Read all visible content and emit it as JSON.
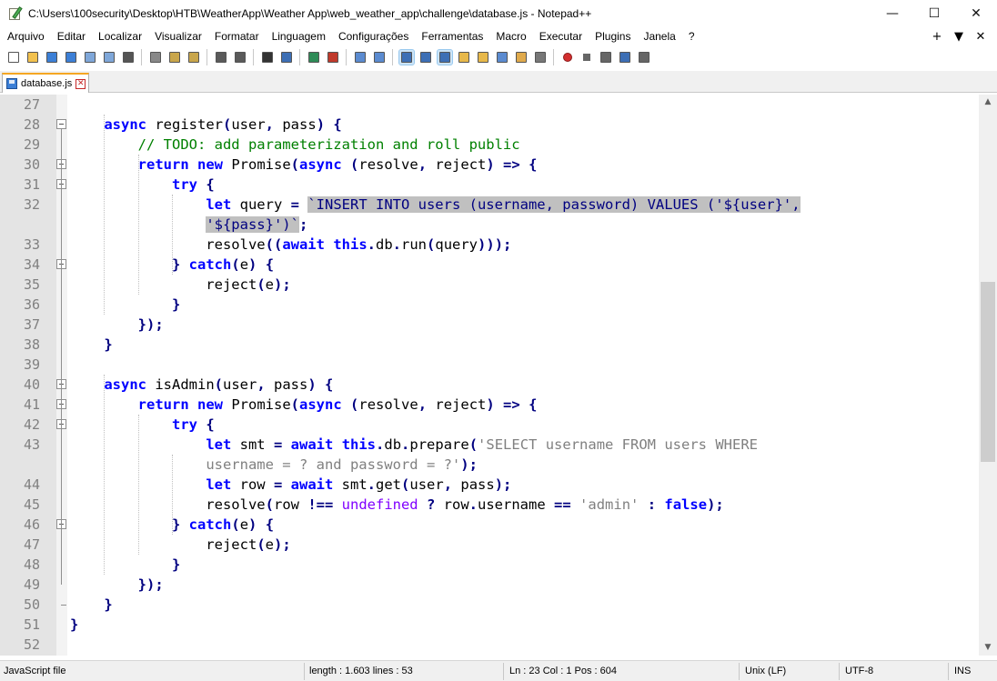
{
  "window": {
    "title": "C:\\Users\\100security\\Desktop\\HTB\\WeatherApp\\Weather App\\web_weather_app\\challenge\\database.js - Notepad++",
    "minimize": "—",
    "maximize": "☐",
    "close": "✕"
  },
  "menu": {
    "items": [
      "Arquivo",
      "Editar",
      "Localizar",
      "Visualizar",
      "Formatar",
      "Linguagem",
      "Configurações",
      "Ferramentas",
      "Macro",
      "Executar",
      "Plugins",
      "Janela",
      "?"
    ],
    "right": [
      "+",
      "▼",
      "✕"
    ]
  },
  "toolbar": {
    "icons": [
      "new-file-icon",
      "open-file-icon",
      "save-icon",
      "save-all-icon",
      "close-icon",
      "close-all-icon",
      "print-icon",
      "cut-icon",
      "copy-icon",
      "paste-icon",
      "undo-icon",
      "redo-icon",
      "find-icon",
      "replace-icon",
      "zoom-in-icon",
      "zoom-out-icon",
      "sync-vertical-icon",
      "sync-horizontal-icon",
      "word-wrap-icon",
      "show-all-chars-icon",
      "indent-guide-icon",
      "udl-icon",
      "doc-map-icon",
      "function-list-icon",
      "folder-workspace-icon",
      "monitoring-icon",
      "record-macro-icon",
      "stop-macro-icon",
      "play-macro-icon",
      "run-macro-multiple-icon",
      "save-macro-icon"
    ]
  },
  "tab": {
    "label": "database.js",
    "close": "✕"
  },
  "editor": {
    "lines": [
      {
        "n": "27",
        "tokens": []
      },
      {
        "n": "28",
        "tokens": [
          [
            "pl",
            "    "
          ],
          [
            "kw",
            "async"
          ],
          [
            "pl",
            " register"
          ],
          [
            "op",
            "("
          ],
          [
            "pl",
            "user"
          ],
          [
            "op",
            ","
          ],
          [
            "pl",
            " pass"
          ],
          [
            "op",
            ")"
          ],
          [
            "pl",
            " "
          ],
          [
            "op",
            "{"
          ]
        ]
      },
      {
        "n": "29",
        "tokens": [
          [
            "pl",
            "        "
          ],
          [
            "cm",
            "// TODO: add parameterization and roll public"
          ]
        ]
      },
      {
        "n": "30",
        "tokens": [
          [
            "pl",
            "        "
          ],
          [
            "kw",
            "return"
          ],
          [
            "pl",
            " "
          ],
          [
            "kw",
            "new"
          ],
          [
            "pl",
            " Promise"
          ],
          [
            "op",
            "("
          ],
          [
            "kw",
            "async"
          ],
          [
            "pl",
            " "
          ],
          [
            "op",
            "("
          ],
          [
            "pl",
            "resolve"
          ],
          [
            "op",
            ","
          ],
          [
            "pl",
            " reject"
          ],
          [
            "op",
            ")"
          ],
          [
            "pl",
            " "
          ],
          [
            "op",
            "=>"
          ],
          [
            "pl",
            " "
          ],
          [
            "op",
            "{"
          ]
        ]
      },
      {
        "n": "31",
        "tokens": [
          [
            "pl",
            "            "
          ],
          [
            "kw",
            "try"
          ],
          [
            "pl",
            " "
          ],
          [
            "op",
            "{"
          ]
        ]
      },
      {
        "n": "32",
        "tokens": [
          [
            "pl",
            "                "
          ],
          [
            "kw",
            "let"
          ],
          [
            "pl",
            " query "
          ],
          [
            "op",
            "="
          ],
          [
            "pl",
            " "
          ],
          [
            "tmpl-sel",
            "`INSERT INTO users (username, password) VALUES ('${user}',"
          ]
        ]
      },
      {
        "n": "",
        "tokens": [
          [
            "pl",
            "                "
          ],
          [
            "tmpl-sel",
            "'${pass}')`"
          ],
          [
            "op",
            ";"
          ]
        ]
      },
      {
        "n": "33",
        "tokens": [
          [
            "pl",
            "                resolve"
          ],
          [
            "op",
            "(("
          ],
          [
            "kw",
            "await"
          ],
          [
            "pl",
            " "
          ],
          [
            "kw",
            "this"
          ],
          [
            "op",
            "."
          ],
          [
            "pl",
            "db"
          ],
          [
            "op",
            "."
          ],
          [
            "pl",
            "run"
          ],
          [
            "op",
            "("
          ],
          [
            "pl",
            "query"
          ],
          [
            "op",
            ")));"
          ]
        ]
      },
      {
        "n": "34",
        "tokens": [
          [
            "pl",
            "            "
          ],
          [
            "op",
            "}"
          ],
          [
            "pl",
            " "
          ],
          [
            "kw",
            "catch"
          ],
          [
            "op",
            "("
          ],
          [
            "pl",
            "e"
          ],
          [
            "op",
            ")"
          ],
          [
            "pl",
            " "
          ],
          [
            "op",
            "{"
          ]
        ]
      },
      {
        "n": "35",
        "tokens": [
          [
            "pl",
            "                reject"
          ],
          [
            "op",
            "("
          ],
          [
            "pl",
            "e"
          ],
          [
            "op",
            ");"
          ]
        ]
      },
      {
        "n": "36",
        "tokens": [
          [
            "pl",
            "            "
          ],
          [
            "op",
            "}"
          ]
        ]
      },
      {
        "n": "37",
        "tokens": [
          [
            "pl",
            "        "
          ],
          [
            "op",
            "});"
          ]
        ]
      },
      {
        "n": "38",
        "tokens": [
          [
            "pl",
            "    "
          ],
          [
            "op",
            "}"
          ]
        ]
      },
      {
        "n": "39",
        "tokens": []
      },
      {
        "n": "40",
        "tokens": [
          [
            "pl",
            "    "
          ],
          [
            "kw",
            "async"
          ],
          [
            "pl",
            " isAdmin"
          ],
          [
            "op",
            "("
          ],
          [
            "pl",
            "user"
          ],
          [
            "op",
            ","
          ],
          [
            "pl",
            " pass"
          ],
          [
            "op",
            ")"
          ],
          [
            "pl",
            " "
          ],
          [
            "op",
            "{"
          ]
        ]
      },
      {
        "n": "41",
        "tokens": [
          [
            "pl",
            "        "
          ],
          [
            "kw",
            "return"
          ],
          [
            "pl",
            " "
          ],
          [
            "kw",
            "new"
          ],
          [
            "pl",
            " Promise"
          ],
          [
            "op",
            "("
          ],
          [
            "kw",
            "async"
          ],
          [
            "pl",
            " "
          ],
          [
            "op",
            "("
          ],
          [
            "pl",
            "resolve"
          ],
          [
            "op",
            ","
          ],
          [
            "pl",
            " reject"
          ],
          [
            "op",
            ")"
          ],
          [
            "pl",
            " "
          ],
          [
            "op",
            "=>"
          ],
          [
            "pl",
            " "
          ],
          [
            "op",
            "{"
          ]
        ]
      },
      {
        "n": "42",
        "tokens": [
          [
            "pl",
            "            "
          ],
          [
            "kw",
            "try"
          ],
          [
            "pl",
            " "
          ],
          [
            "op",
            "{"
          ]
        ]
      },
      {
        "n": "43",
        "tokens": [
          [
            "pl",
            "                "
          ],
          [
            "kw",
            "let"
          ],
          [
            "pl",
            " smt "
          ],
          [
            "op",
            "="
          ],
          [
            "pl",
            " "
          ],
          [
            "kw",
            "await"
          ],
          [
            "pl",
            " "
          ],
          [
            "kw",
            "this"
          ],
          [
            "op",
            "."
          ],
          [
            "pl",
            "db"
          ],
          [
            "op",
            "."
          ],
          [
            "pl",
            "prepare"
          ],
          [
            "op",
            "("
          ],
          [
            "str",
            "'SELECT username FROM users WHERE"
          ]
        ]
      },
      {
        "n": "",
        "tokens": [
          [
            "pl",
            "                "
          ],
          [
            "str",
            "username = ? and password = ?'"
          ],
          [
            "op",
            ");"
          ]
        ]
      },
      {
        "n": "44",
        "tokens": [
          [
            "pl",
            "                "
          ],
          [
            "kw",
            "let"
          ],
          [
            "pl",
            " row "
          ],
          [
            "op",
            "="
          ],
          [
            "pl",
            " "
          ],
          [
            "kw",
            "await"
          ],
          [
            "pl",
            " smt"
          ],
          [
            "op",
            "."
          ],
          [
            "pl",
            "get"
          ],
          [
            "op",
            "("
          ],
          [
            "pl",
            "user"
          ],
          [
            "op",
            ","
          ],
          [
            "pl",
            " pass"
          ],
          [
            "op",
            ");"
          ]
        ]
      },
      {
        "n": "45",
        "tokens": [
          [
            "pl",
            "                resolve"
          ],
          [
            "op",
            "("
          ],
          [
            "pl",
            "row "
          ],
          [
            "op",
            "!=="
          ],
          [
            "pl",
            " "
          ],
          [
            "kw2",
            "undefined"
          ],
          [
            "pl",
            " "
          ],
          [
            "op",
            "?"
          ],
          [
            "pl",
            " row"
          ],
          [
            "op",
            "."
          ],
          [
            "pl",
            "username "
          ],
          [
            "op",
            "=="
          ],
          [
            "pl",
            " "
          ],
          [
            "str",
            "'admin'"
          ],
          [
            "pl",
            " "
          ],
          [
            "op",
            ":"
          ],
          [
            "pl",
            " "
          ],
          [
            "kw",
            "false"
          ],
          [
            "op",
            ");"
          ]
        ]
      },
      {
        "n": "46",
        "tokens": [
          [
            "pl",
            "            "
          ],
          [
            "op",
            "}"
          ],
          [
            "pl",
            " "
          ],
          [
            "kw",
            "catch"
          ],
          [
            "op",
            "("
          ],
          [
            "pl",
            "e"
          ],
          [
            "op",
            ")"
          ],
          [
            "pl",
            " "
          ],
          [
            "op",
            "{"
          ]
        ]
      },
      {
        "n": "47",
        "tokens": [
          [
            "pl",
            "                reject"
          ],
          [
            "op",
            "("
          ],
          [
            "pl",
            "e"
          ],
          [
            "op",
            ");"
          ]
        ]
      },
      {
        "n": "48",
        "tokens": [
          [
            "pl",
            "            "
          ],
          [
            "op",
            "}"
          ]
        ]
      },
      {
        "n": "49",
        "tokens": [
          [
            "pl",
            "        "
          ],
          [
            "op",
            "});"
          ]
        ]
      },
      {
        "n": "50",
        "tokens": [
          [
            "pl",
            "    "
          ],
          [
            "op",
            "}"
          ]
        ]
      },
      {
        "n": "51",
        "tokens": [
          [
            "op",
            "}"
          ]
        ]
      },
      {
        "n": "52",
        "tokens": []
      }
    ],
    "fold_markers": [
      "28",
      "30",
      "31",
      "34",
      "40",
      "41",
      "42",
      "46"
    ]
  },
  "statusbar": {
    "file_type": "JavaScript file",
    "length_lines": "length : 1.603    lines : 53",
    "position": "Ln : 23    Col : 1    Pos : 604",
    "eol": "Unix (LF)",
    "encoding": "UTF-8",
    "mode": "INS"
  }
}
